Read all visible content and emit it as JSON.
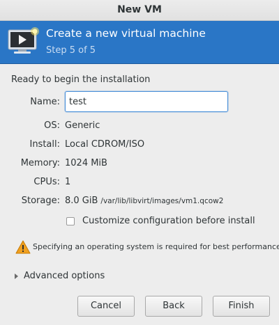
{
  "window": {
    "title": "New VM"
  },
  "banner": {
    "icon": "vm-monitor-icon",
    "title": "Create a new virtual machine",
    "step": "Step 5 of 5"
  },
  "summary": {
    "heading": "Ready to begin the installation",
    "name_label": "Name:",
    "name_value": "test",
    "os_label": "OS:",
    "os_value": "Generic",
    "install_label": "Install:",
    "install_value": "Local CDROM/ISO",
    "memory_label": "Memory:",
    "memory_value": "1024 MiB",
    "cpus_label": "CPUs:",
    "cpus_value": "1",
    "storage_label": "Storage:",
    "storage_size": "8.0 GiB",
    "storage_path": "/var/lib/libvirt/images/vm1.qcow2"
  },
  "customize": {
    "label": "Customize configuration before install",
    "checked": false
  },
  "warning": {
    "icon": "warning-icon",
    "text": "Specifying an operating system is required for best performance"
  },
  "advanced": {
    "label": "Advanced options",
    "expanded": false
  },
  "buttons": {
    "cancel": "Cancel",
    "back": "Back",
    "finish": "Finish"
  },
  "colors": {
    "banner": "#2a76c6",
    "focus": "#4a90d9",
    "warning": "#f0a020"
  }
}
